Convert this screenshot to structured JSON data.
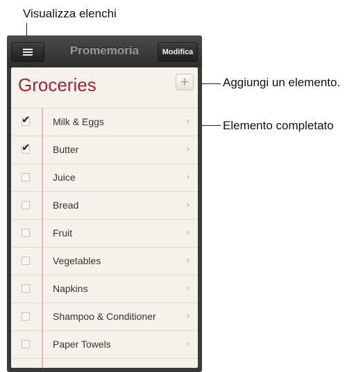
{
  "callouts": {
    "show_lists": "Visualizza elenchi",
    "add_item": "Aggiungi un elemento.",
    "completed_item": "Elemento completato"
  },
  "navbar": {
    "title": "Promemoria",
    "edit_label": "Modifica",
    "menu_icon": "hamburger-menu-icon"
  },
  "list": {
    "title": "Groceries",
    "add_label": "+",
    "items": [
      {
        "label": "Milk & Eggs",
        "completed": true
      },
      {
        "label": "Butter",
        "completed": true
      },
      {
        "label": "Juice",
        "completed": false
      },
      {
        "label": "Bread",
        "completed": false
      },
      {
        "label": "Fruit",
        "completed": false
      },
      {
        "label": "Vegetables",
        "completed": false
      },
      {
        "label": "Napkins",
        "completed": false
      },
      {
        "label": "Shampoo & Conditioner",
        "completed": false
      },
      {
        "label": "Paper Towels",
        "completed": false
      }
    ]
  },
  "colors": {
    "list_title": "#a0263a",
    "paper": "#f4f2ea",
    "margin_line": "#e9b8bf",
    "navbar": "#3a3a3a"
  }
}
